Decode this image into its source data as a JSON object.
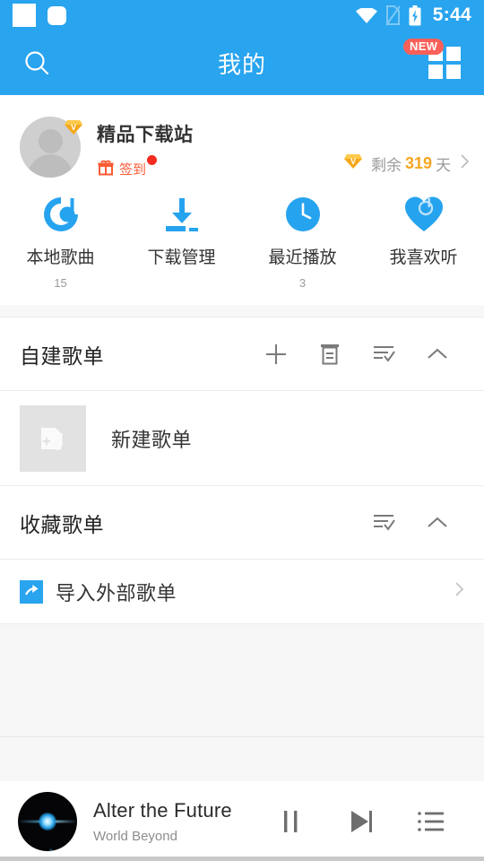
{
  "status_bar": {
    "time": "5:44",
    "icons": [
      "notification-square",
      "notification-square-rounded",
      "wifi-icon",
      "sim-card-off-icon",
      "battery-charging-icon"
    ]
  },
  "app_bar": {
    "title": "我的",
    "search_icon": "search-icon",
    "grid_icon": "grid-icon",
    "new_badge": "NEW"
  },
  "profile": {
    "username": "精品下载站",
    "avatar_icon": "default-avatar-icon",
    "vip_badge": "V",
    "signin_label": "签到",
    "signin_icon": "gift-icon",
    "has_unread_dot": true,
    "vip_prefix": "剩余",
    "vip_days": "319",
    "vip_suffix": "天",
    "vip_diamond_color": "#f5a623",
    "chevron_icon": "chevron-right-icon"
  },
  "quick_actions": [
    {
      "label": "本地歌曲",
      "count": "15",
      "icon": "local-music-icon"
    },
    {
      "label": "下载管理",
      "count": "",
      "icon": "download-icon"
    },
    {
      "label": "最近播放",
      "count": "3",
      "icon": "clock-icon"
    },
    {
      "label": "我喜欢听",
      "count": "",
      "icon": "heart-icon"
    }
  ],
  "sections": [
    {
      "title": "自建歌单",
      "actions": [
        "plus-icon",
        "trash-icon",
        "sort-check-icon",
        "chevron-up-icon"
      ]
    },
    {
      "title": "收藏歌单",
      "actions": [
        "sort-check-icon",
        "chevron-up-icon"
      ]
    }
  ],
  "create_playlist_row": {
    "label": "新建歌单",
    "icon": "add-playlist-icon"
  },
  "import_row": {
    "label": "导入外部歌单",
    "icon": "import-arrow-icon",
    "chevron_icon": "chevron-right-icon"
  },
  "player": {
    "track_title": "Alter the Future",
    "artist": "World Beyond",
    "album_art_icon": "album-art-thumbnail",
    "pause_icon": "pause-icon",
    "next_icon": "next-track-icon",
    "queue_icon": "playlist-queue-icon",
    "progress_percent": 51
  },
  "theme": {
    "accent": "#29a4ef",
    "badge_red": "#fa6059",
    "vip_gold": "#f5a623",
    "signin_orange": "#fa5a33",
    "page_bg": "#f7f7f7"
  }
}
